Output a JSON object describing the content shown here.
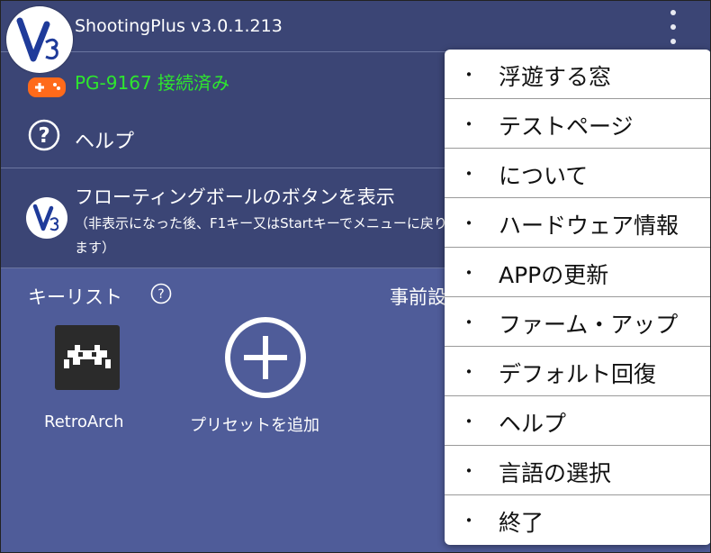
{
  "app": {
    "title": "ShootingPlus v3.0.1.213"
  },
  "device": {
    "status": "PG-9167 接続済み"
  },
  "help_row": {
    "label": "ヘルプ"
  },
  "floating": {
    "title": "フローティングボールのボタンを表示",
    "description": "（非表示になった後、F1キー又はStartキーでメニューに戻ります）"
  },
  "keys": {
    "label": "キーリスト",
    "preset_label": "事前設定",
    "items": [
      {
        "label": "RetroArch",
        "icon": "retroarch-icon"
      },
      {
        "label": "プリセットを追加",
        "icon": "add-circle-icon"
      }
    ]
  },
  "menu": {
    "bullet": "・",
    "items": [
      "浮遊する窓",
      "テストページ",
      "について",
      "ハードウェア情報",
      "APPの更新",
      "ファーム・アップ",
      "デフォルト回復",
      "ヘルプ",
      "言語の選択",
      "終了"
    ]
  },
  "colors": {
    "header_bg": "#3b4575",
    "keys_bg": "#4f5c99",
    "connected_green": "#2ee62e",
    "gamepad_orange": "#ff6a1a"
  }
}
